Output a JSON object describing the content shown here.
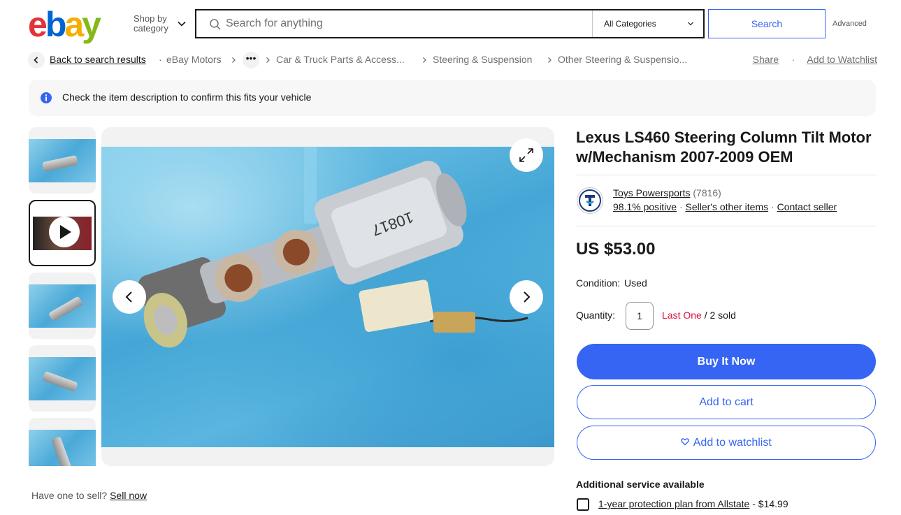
{
  "header": {
    "logo_letters": [
      "e",
      "b",
      "a",
      "y"
    ],
    "shop_by_line1": "Shop by",
    "shop_by_line2": "category",
    "search_placeholder": "Search for anything",
    "category_selected": "All Categories",
    "search_button": "Search",
    "advanced_link": "Advanced"
  },
  "breadcrumb": {
    "back": "Back to search results",
    "items": [
      "eBay Motors",
      "Car & Truck Parts & Access...",
      "Steering & Suspension",
      "Other Steering & Suspensio..."
    ],
    "more": "•••",
    "separator_dot": "·",
    "share": "Share",
    "add_to_watchlist": "Add to Watchlist"
  },
  "notice": {
    "text": "Check the item description to confirm this fits your vehicle"
  },
  "item": {
    "title": "Lexus LS460 Steering Column Tilt Motor w/Mechanism 2007-2009 OEM",
    "price": "US $53.00",
    "condition_label": "Condition:",
    "condition_value": "Used",
    "quantity_label": "Quantity:",
    "quantity_value": "1",
    "quantity_last": "Last One",
    "quantity_sold": " / 2 sold"
  },
  "seller": {
    "name": "Toys Powersports",
    "feedback_count": "(7816)",
    "positive": "98.1% positive",
    "other_items": "Seller's other items",
    "contact": "Contact seller",
    "dot": "·"
  },
  "actions": {
    "buy_it_now": "Buy It Now",
    "add_to_cart": "Add to cart",
    "add_to_watchlist": "Add to watchlist"
  },
  "additional_service": {
    "heading": "Additional service available",
    "plan_link": "1-year protection plan from Allstate",
    "plan_price": " - $14.99"
  },
  "sell_prompt": {
    "text": "Have one to sell?",
    "link": "Sell now"
  },
  "colors": {
    "primary_blue": "#3665f3",
    "last_one_red": "#e0103a"
  }
}
